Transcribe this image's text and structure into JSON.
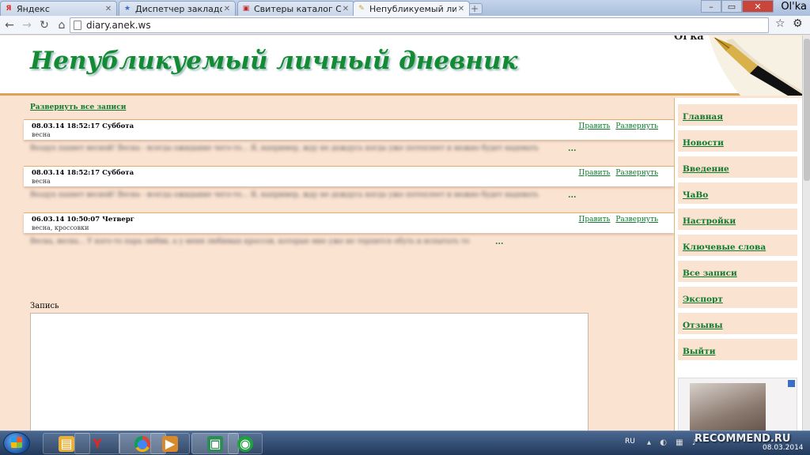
{
  "browser": {
    "tabs": [
      {
        "title": "Яндекс",
        "favicon": "Я",
        "favicon_color": "#e52620",
        "active": false
      },
      {
        "title": "Диспетчер закладок",
        "favicon": "★",
        "favicon_color": "#3d6bc4",
        "active": false
      },
      {
        "title": "Свитеры каталог Cardig...",
        "favicon": "▣",
        "favicon_color": "#c62828",
        "active": false
      },
      {
        "title": "Непубликуемый личны...",
        "favicon": "✎",
        "favicon_color": "#c9a227",
        "active": true
      }
    ],
    "profile_name": "Ol'ka",
    "address": "diary.anek.ws"
  },
  "site": {
    "title": "Непубликуемый личный дневник",
    "username": "Ol'ka",
    "expand_all": "Развернуть все записи",
    "record_label": "Запись"
  },
  "entries": [
    {
      "date": "08.03.14 18:52:17 Суббота",
      "tags": "весна",
      "edit": "Править",
      "expand": "Развернуть",
      "preview": "Воздух пахнет весной! Весна - всегда ожидание чего-то... Я, например, жду не дождусь когда уже потеплеет и можно будет надевать",
      "more": "..."
    },
    {
      "date": "08.03.14 18:52:17 Суббота",
      "tags": "весна",
      "edit": "Править",
      "expand": "Развернуть",
      "preview": "Воздух пахнет весной! Весна - всегда ожидание чего-то... Я, например, жду не дождусь когда уже потеплеет и можно будет надевать",
      "more": "..."
    },
    {
      "date": "06.03.14 10:50:07 Четверг",
      "tags": "весна, кроссовки",
      "edit": "Править",
      "expand": "Развернуть",
      "preview": "Весна, весна... У кого-то пара любви, а у меня любимых кроссов, которые мне уже не терпится обуть и испытать то",
      "more": "..."
    }
  ],
  "menu": [
    "Главная",
    "Новости",
    "Введение",
    "ЧаВо",
    "Настройки",
    "Ключевые слова",
    "Все записи",
    "Экспорт",
    "Отзывы",
    "Выйти"
  ],
  "taskbar": {
    "apps": [
      {
        "name": "explorer",
        "glyph": "▤",
        "color": "#e8b13c"
      },
      {
        "name": "yandex-browser",
        "glyph": "Y",
        "color": "#e52620"
      },
      {
        "name": "chrome",
        "glyph": "●",
        "color": "#4caf50"
      },
      {
        "name": "media-player",
        "glyph": "▶",
        "color": "#d88a2a"
      },
      {
        "name": "screen-app",
        "glyph": "▣",
        "color": "#2e8b57"
      },
      {
        "name": "network-app",
        "glyph": "◉",
        "color": "#21a041"
      }
    ],
    "lang": "RU",
    "watermark": "RECOMMEND.RU",
    "date": "08.03.2014"
  },
  "colors": {
    "accent": "#138b33",
    "page_bg": "#fbe3d2",
    "header_line": "#d9a45a"
  }
}
